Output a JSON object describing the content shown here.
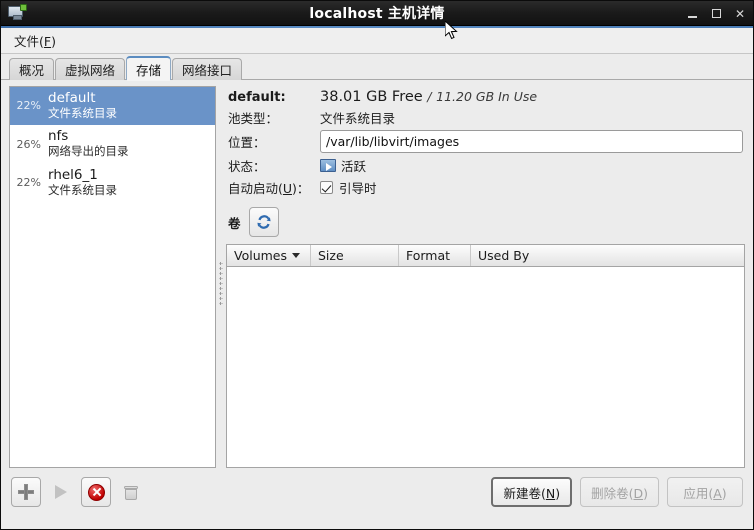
{
  "window": {
    "title": "localhost 主机详情",
    "icon": "host-monitor-icon",
    "minimize": "_",
    "maximize": "□",
    "close": "✕"
  },
  "menubar": {
    "items": [
      {
        "label": "文件(F)",
        "text": "文件(",
        "accel": "F",
        "tail": ")"
      }
    ]
  },
  "tabs": [
    {
      "label": "概况",
      "active": false
    },
    {
      "label": "虚拟网络",
      "active": false
    },
    {
      "label": "存储",
      "active": true
    },
    {
      "label": "网络接口",
      "active": false
    }
  ],
  "pool_list": [
    {
      "percent": "22%",
      "name": "default",
      "type": "文件系统目录",
      "selected": true
    },
    {
      "percent": "26%",
      "name": "nfs",
      "type": "网络导出的目录",
      "selected": false
    },
    {
      "percent": "22%",
      "name": "rhel6_1",
      "type": "文件系统目录",
      "selected": false
    }
  ],
  "details": {
    "name_label": "default:",
    "free_text": "38.01 GB Free",
    "separator": "/",
    "used_text": "11.20 GB In Use",
    "pool_type_label": "池类型：",
    "pool_type_value": "文件系统目录",
    "location_label": "位置：",
    "location_value": "/var/lib/libvirt/images",
    "state_label": "状态：",
    "state_value": "活跃",
    "state_icon": "running-monitor-icon",
    "autostart_label_text": "自动启动(",
    "autostart_accel": "U",
    "autostart_label_tail": ")：",
    "autostart_checked": true,
    "autostart_value": "引导时"
  },
  "volumes": {
    "section_label": "卷",
    "refresh_icon": "refresh-icon",
    "columns": [
      "Volumes",
      "Size",
      "Format",
      "Used By"
    ],
    "rows": []
  },
  "footer": {
    "icon_buttons": [
      {
        "name": "add-pool-button",
        "icon": "plus-icon",
        "enabled": true
      },
      {
        "name": "start-pool-button",
        "icon": "play-icon",
        "enabled": false
      },
      {
        "name": "stop-pool-button",
        "icon": "stop-icon",
        "enabled": true
      },
      {
        "name": "delete-pool-button",
        "icon": "trash-icon",
        "enabled": false
      }
    ],
    "new_volume": {
      "text": "新建卷(",
      "accel": "N",
      "tail": ")",
      "enabled": true
    },
    "delete_volume": {
      "text": "删除卷(",
      "accel": "D",
      "tail": ")",
      "enabled": false
    },
    "apply": {
      "text": "应用(",
      "accel": "A",
      "tail": ")",
      "enabled": false
    }
  },
  "colors": {
    "selection": "#6a93c8",
    "titlebar": "#1a1a1a",
    "accent_underline": "#4a7cb5",
    "stop_red": "#c00000",
    "window_bg": "#ececec"
  }
}
